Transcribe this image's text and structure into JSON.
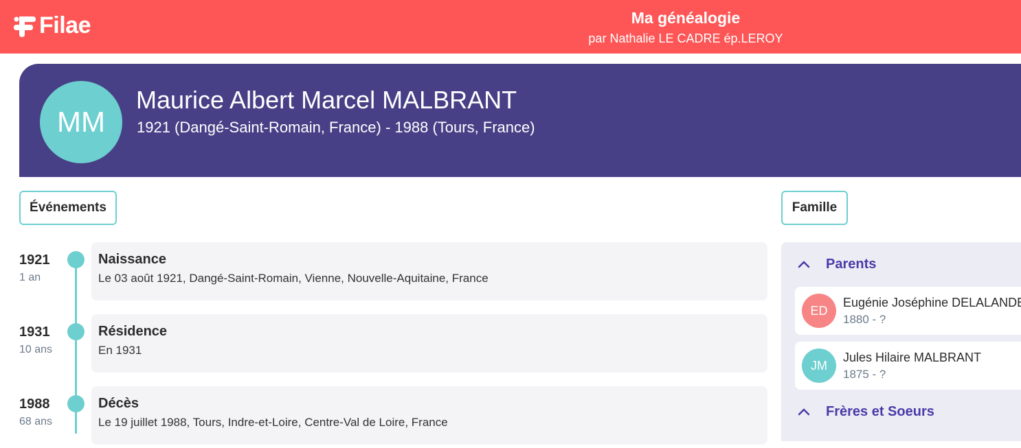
{
  "header": {
    "logo_text": "Filae",
    "title": "Ma généalogie",
    "subtitle": "par Nathalie LE CADRE ép.LEROY"
  },
  "person": {
    "initials": "MM",
    "name": "Maurice Albert Marcel MALBRANT",
    "dates": "1921 (Dangé-Saint-Romain, France) - 1988 (Tours, France)"
  },
  "sections": {
    "events_label": "Événements",
    "family_label": "Famille"
  },
  "events": [
    {
      "year": "1921",
      "age": "1 an",
      "title": "Naissance",
      "description": "Le 03 août 1921, Dangé-Saint-Romain, Vienne, Nouvelle-Aquitaine, France"
    },
    {
      "year": "1931",
      "age": "10 ans",
      "title": "Résidence",
      "description": "En 1931"
    },
    {
      "year": "1988",
      "age": "68 ans",
      "title": "Décès",
      "description": "Le 19 juillet 1988, Tours, Indre-et-Loire, Centre-Val de Loire, France"
    }
  ],
  "family": {
    "parents_label": "Parents",
    "siblings_label": "Frères et Soeurs",
    "parents": [
      {
        "initials": "ED",
        "name": "Eugénie Joséphine DELALANDE",
        "dates": "1880 - ?",
        "color": "#f88585"
      },
      {
        "initials": "JM",
        "name": "Jules Hilaire MALBRANT",
        "dates": "1875 - ?",
        "color": "#6dcfd0"
      }
    ]
  },
  "colors": {
    "topbar": "#fe5656",
    "hero": "#474086",
    "accent_teal": "#6dcfd0",
    "family_title": "#4a3aa8"
  }
}
